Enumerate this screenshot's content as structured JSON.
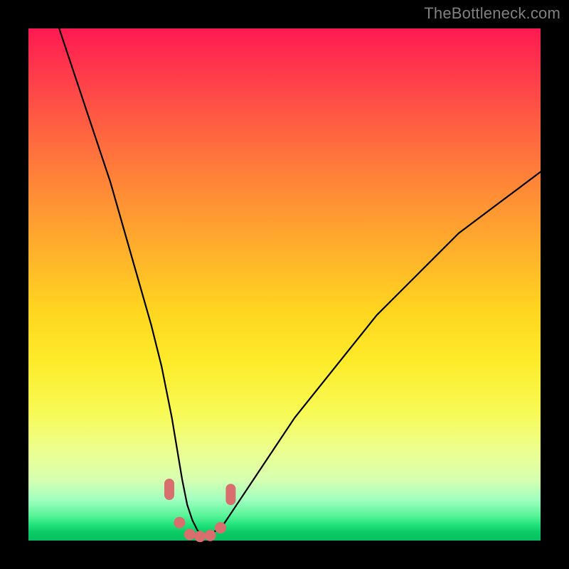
{
  "watermark": "TheBottleneck.com",
  "colors": {
    "page_bg": "#000000",
    "curve": "#000000",
    "marker": "#d96e6e",
    "watermark_text": "#808080"
  },
  "chart_data": {
    "type": "line",
    "title": "",
    "xlabel": "",
    "ylabel": "",
    "xlim": [
      0,
      100
    ],
    "ylim": [
      0,
      100
    ],
    "grid": false,
    "legend": null,
    "series": [
      {
        "name": "bottleneck-curve",
        "x": [
          6,
          8,
          10,
          12,
          14,
          16,
          18,
          20,
          22,
          24,
          26,
          27,
          28,
          29,
          30,
          31,
          32,
          33,
          34,
          35,
          36,
          38,
          40,
          44,
          48,
          52,
          56,
          60,
          64,
          68,
          72,
          76,
          80,
          84,
          88,
          92,
          96,
          100
        ],
        "values": [
          100,
          94,
          88,
          82,
          76,
          70,
          63,
          56,
          49,
          42,
          34,
          29,
          24,
          18,
          12,
          7,
          4,
          2,
          1,
          1,
          1.5,
          3,
          6,
          12,
          18,
          24,
          29,
          34,
          39,
          44,
          48,
          52,
          56,
          60,
          63,
          66,
          69,
          72
        ]
      }
    ],
    "annotations": {
      "markers": [
        {
          "x": 27.5,
          "y": 10,
          "shape": "capsule-vertical"
        },
        {
          "x": 29.5,
          "y": 3.5,
          "shape": "circle"
        },
        {
          "x": 31.5,
          "y": 1.2,
          "shape": "circle"
        },
        {
          "x": 33.5,
          "y": 0.8,
          "shape": "circle"
        },
        {
          "x": 35.5,
          "y": 1.0,
          "shape": "circle"
        },
        {
          "x": 37.5,
          "y": 2.5,
          "shape": "circle"
        },
        {
          "x": 39.5,
          "y": 9.0,
          "shape": "capsule-vertical"
        }
      ]
    }
  }
}
